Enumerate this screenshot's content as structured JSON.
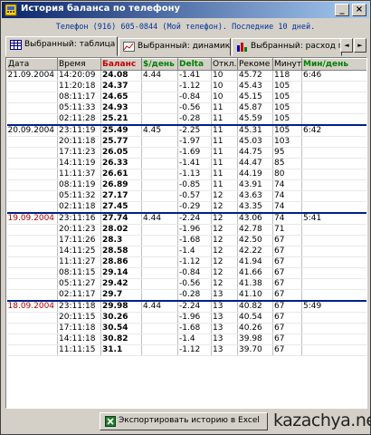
{
  "window": {
    "title": "История баланса по телефону",
    "btn_minimize": "_",
    "btn_close": "×"
  },
  "subtitle": "Телефон (916) 605-0844 (Мой телефон). Последние 10 дней.",
  "tabs": [
    {
      "label": "Выбранный: таблица",
      "icon": "table-icon"
    },
    {
      "label": "Выбранный: динамика",
      "icon": "chart-icon"
    },
    {
      "label": "Выбранный: расход по...",
      "icon": "bar-chart-icon"
    }
  ],
  "tab_scroll": {
    "left": "◄",
    "right": "►"
  },
  "table": {
    "columns": [
      "Дата",
      "Время",
      "Баланс",
      "$/день",
      "Delta",
      "Откл.",
      "Рекоме",
      "Минут",
      "Мин/день"
    ],
    "rows": [
      {
        "date": "21.09.2004",
        "time": "14:20:09",
        "bal": "24.08",
        "per": "4.44",
        "delta": "-1.41",
        "dev": "10",
        "rec": "45.72",
        "min": "118",
        "minday": "6:46",
        "sep": true,
        "red": false
      },
      {
        "date": "",
        "time": "11:20:18",
        "bal": "24.37",
        "per": "",
        "delta": "-1.12",
        "dev": "10",
        "rec": "45.43",
        "min": "105",
        "minday": "",
        "sep": false,
        "red": false
      },
      {
        "date": "",
        "time": "08:11:17",
        "bal": "24.65",
        "per": "",
        "delta": "-0.84",
        "dev": "10",
        "rec": "45.15",
        "min": "105",
        "minday": "",
        "sep": false,
        "red": false
      },
      {
        "date": "",
        "time": "05:11:33",
        "bal": "24.93",
        "per": "",
        "delta": "-0.56",
        "dev": "11",
        "rec": "45.87",
        "min": "105",
        "minday": "",
        "sep": false,
        "red": false
      },
      {
        "date": "",
        "time": "02:11:28",
        "bal": "25.21",
        "per": "",
        "delta": "-0.28",
        "dev": "11",
        "rec": "45.59",
        "min": "105",
        "minday": "",
        "sep": false,
        "red": false
      },
      {
        "date": "20.09.2004",
        "time": "23:11:19",
        "bal": "25.49",
        "per": "4.45",
        "delta": "-2.25",
        "dev": "11",
        "rec": "45.31",
        "min": "105",
        "minday": "6:42",
        "sep": true,
        "red": false
      },
      {
        "date": "",
        "time": "20:11:18",
        "bal": "25.77",
        "per": "",
        "delta": "-1.97",
        "dev": "11",
        "rec": "45.03",
        "min": "103",
        "minday": "",
        "sep": false,
        "red": false
      },
      {
        "date": "",
        "time": "17:11:23",
        "bal": "26.05",
        "per": "",
        "delta": "-1.69",
        "dev": "11",
        "rec": "44.75",
        "min": "95",
        "minday": "",
        "sep": false,
        "red": false
      },
      {
        "date": "",
        "time": "14:11:19",
        "bal": "26.33",
        "per": "",
        "delta": "-1.41",
        "dev": "11",
        "rec": "44.47",
        "min": "85",
        "minday": "",
        "sep": false,
        "red": false
      },
      {
        "date": "",
        "time": "11:11:37",
        "bal": "26.61",
        "per": "",
        "delta": "-1.13",
        "dev": "11",
        "rec": "44.19",
        "min": "80",
        "minday": "",
        "sep": false,
        "red": false
      },
      {
        "date": "",
        "time": "08:11:19",
        "bal": "26.89",
        "per": "",
        "delta": "-0.85",
        "dev": "11",
        "rec": "43.91",
        "min": "74",
        "minday": "",
        "sep": false,
        "red": false
      },
      {
        "date": "",
        "time": "05:11:32",
        "bal": "27.17",
        "per": "",
        "delta": "-0.57",
        "dev": "12",
        "rec": "43.63",
        "min": "74",
        "minday": "",
        "sep": false,
        "red": false
      },
      {
        "date": "",
        "time": "02:11:18",
        "bal": "27.45",
        "per": "",
        "delta": "-0.29",
        "dev": "12",
        "rec": "43.35",
        "min": "74",
        "minday": "",
        "sep": false,
        "red": false
      },
      {
        "date": "19.09.2004",
        "time": "23:11:16",
        "bal": "27.74",
        "per": "4.44",
        "delta": "-2.24",
        "dev": "12",
        "rec": "43.06",
        "min": "74",
        "minday": "5:41",
        "sep": true,
        "red": true
      },
      {
        "date": "",
        "time": "20:11:23",
        "bal": "28.02",
        "per": "",
        "delta": "-1.96",
        "dev": "12",
        "rec": "42.78",
        "min": "71",
        "minday": "",
        "sep": false,
        "red": false
      },
      {
        "date": "",
        "time": "17:11:26",
        "bal": "28.3",
        "per": "",
        "delta": "-1.68",
        "dev": "12",
        "rec": "42.50",
        "min": "67",
        "minday": "",
        "sep": false,
        "red": false
      },
      {
        "date": "",
        "time": "14:11:25",
        "bal": "28.58",
        "per": "",
        "delta": "-1.4",
        "dev": "12",
        "rec": "42.22",
        "min": "67",
        "minday": "",
        "sep": false,
        "red": false
      },
      {
        "date": "",
        "time": "11:11:27",
        "bal": "28.86",
        "per": "",
        "delta": "-1.12",
        "dev": "12",
        "rec": "41.94",
        "min": "67",
        "minday": "",
        "sep": false,
        "red": false
      },
      {
        "date": "",
        "time": "08:11:15",
        "bal": "29.14",
        "per": "",
        "delta": "-0.84",
        "dev": "12",
        "rec": "41.66",
        "min": "67",
        "minday": "",
        "sep": false,
        "red": false
      },
      {
        "date": "",
        "time": "05:11:27",
        "bal": "29.42",
        "per": "",
        "delta": "-0.56",
        "dev": "12",
        "rec": "41.38",
        "min": "67",
        "minday": "",
        "sep": false,
        "red": false
      },
      {
        "date": "",
        "time": "02:11:17",
        "bal": "29.7",
        "per": "",
        "delta": "-0.28",
        "dev": "13",
        "rec": "41.10",
        "min": "67",
        "minday": "",
        "sep": false,
        "red": false
      },
      {
        "date": "18.09.2004",
        "time": "23:11:18",
        "bal": "29.98",
        "per": "4.44",
        "delta": "-2.24",
        "dev": "13",
        "rec": "40.82",
        "min": "67",
        "minday": "5:49",
        "sep": true,
        "red": true
      },
      {
        "date": "",
        "time": "20:11:15",
        "bal": "30.26",
        "per": "",
        "delta": "-1.96",
        "dev": "13",
        "rec": "40.54",
        "min": "67",
        "minday": "",
        "sep": false,
        "red": false
      },
      {
        "date": "",
        "time": "17:11:18",
        "bal": "30.54",
        "per": "",
        "delta": "-1.68",
        "dev": "13",
        "rec": "40.26",
        "min": "67",
        "minday": "",
        "sep": false,
        "red": false
      },
      {
        "date": "",
        "time": "14:11:18",
        "bal": "30.82",
        "per": "",
        "delta": "-1.4",
        "dev": "13",
        "rec": "39.98",
        "min": "67",
        "minday": "",
        "sep": false,
        "red": false
      },
      {
        "date": "",
        "time": "11:11:15",
        "bal": "31.1",
        "per": "",
        "delta": "-1.12",
        "dev": "13",
        "rec": "39.70",
        "min": "67",
        "minday": "",
        "sep": false,
        "red": false
      }
    ]
  },
  "export_button": "Экспортировать историю в Excel",
  "watermark": "kazachya.net",
  "colors": {
    "balance_header": "#c00000",
    "per_day_header": "#008000",
    "delta_header": "#008000",
    "minday_header": "#008000",
    "day_separator": "#00208a",
    "red_date": "#b00000"
  }
}
